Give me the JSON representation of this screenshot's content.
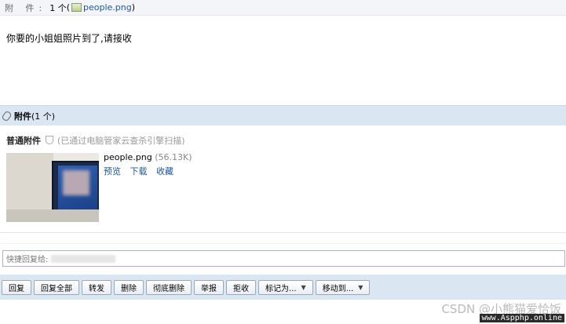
{
  "attachment_line": {
    "label": "附 件:",
    "count": "1 个",
    "open_paren": "(",
    "filename": "people.png",
    "close_paren": ")"
  },
  "message": {
    "body": "你要的小姐姐照片到了,请接收"
  },
  "attachments_section": {
    "title": "附件",
    "count": "(1 个)",
    "normal_label": "普通附件",
    "scan_note": "(已通过电脑管家云查杀引擎扫描)"
  },
  "file": {
    "name": "people.png",
    "size": "(56.13K)",
    "actions": [
      "预览",
      "下载",
      "收藏"
    ]
  },
  "quick_reply": {
    "placeholder": "快捷回复给:"
  },
  "toolbar": {
    "buttons": [
      "回复",
      "回复全部",
      "转发",
      "删除",
      "彻底删除",
      "举报",
      "拒收"
    ],
    "mark_as": "标记为...",
    "move_to": "移动到..."
  },
  "watermark": {
    "csdn": "CSDN @小熊猫爱恰饭",
    "site": "www.Aspphp.online"
  },
  "icons": {
    "file": "image-file-icon",
    "clip": "paperclip-icon",
    "shield": "shield-icon",
    "caret": "caret-down-icon"
  }
}
